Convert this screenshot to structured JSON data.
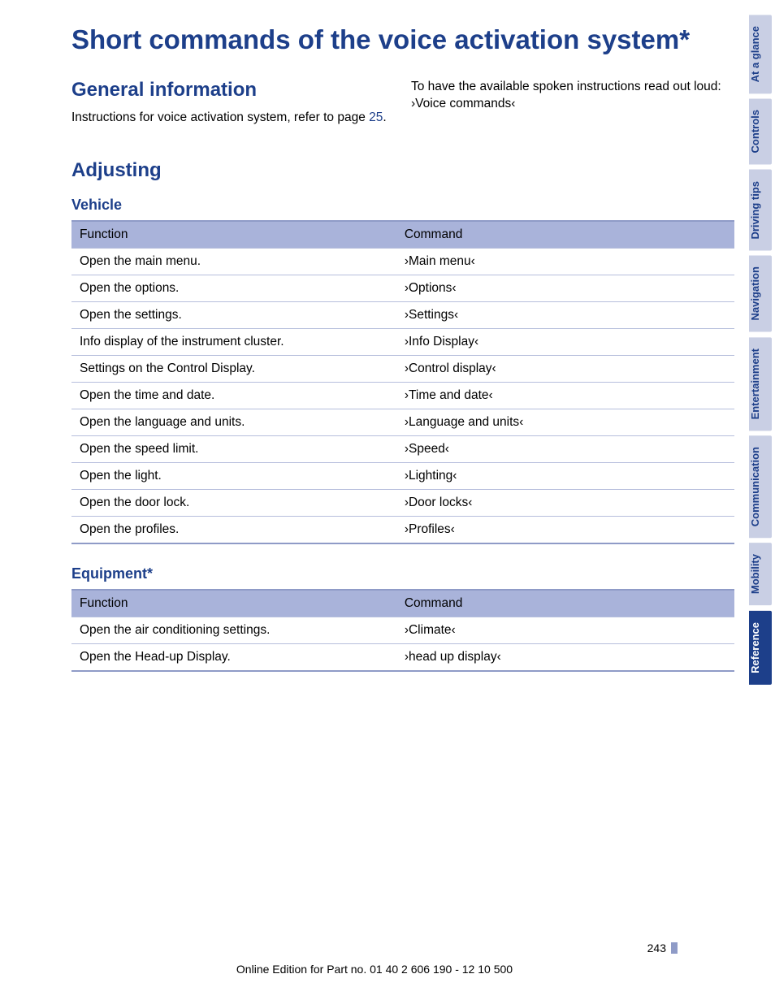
{
  "title": "Short commands of the voice activation system*",
  "general": {
    "heading": "General information",
    "text_prefix": "Instructions for voice activation system, refer to page ",
    "page_ref": "25",
    "text_suffix": ".",
    "right_text": "To have the available spoken instructions read out loud: ›Voice commands‹"
  },
  "adjusting": {
    "heading": "Adjusting",
    "vehicle": {
      "heading": "Vehicle",
      "header_function": "Function",
      "header_command": "Command",
      "rows": [
        {
          "f": "Open the main menu.",
          "c": "›Main menu‹"
        },
        {
          "f": "Open the options.",
          "c": "›Options‹"
        },
        {
          "f": "Open the settings.",
          "c": "›Settings‹"
        },
        {
          "f": "Info display of the instrument cluster.",
          "c": "›Info Display‹"
        },
        {
          "f": "Settings on the Control Display.",
          "c": "›Control display‹"
        },
        {
          "f": "Open the time and date.",
          "c": "›Time and date‹"
        },
        {
          "f": "Open the language and units.",
          "c": "›Language and units‹"
        },
        {
          "f": "Open the speed limit.",
          "c": "›Speed‹"
        },
        {
          "f": "Open the light.",
          "c": "›Lighting‹"
        },
        {
          "f": "Open the door lock.",
          "c": "›Door locks‹"
        },
        {
          "f": "Open the profiles.",
          "c": "›Profiles‹"
        }
      ]
    },
    "equipment": {
      "heading": "Equipment*",
      "header_function": "Function",
      "header_command": "Command",
      "rows": [
        {
          "f": "Open the air conditioning settings.",
          "c": "›Climate‹"
        },
        {
          "f": "Open the Head-up Display.",
          "c": "›head up display‹"
        }
      ]
    }
  },
  "side_tabs": [
    "At a glance",
    "Controls",
    "Driving tips",
    "Navigation",
    "Entertainment",
    "Communication",
    "Mobility",
    "Reference"
  ],
  "active_tab_index": 7,
  "page_number": "243",
  "footer": "Online Edition for Part no. 01 40 2 606 190 - 12 10 500"
}
